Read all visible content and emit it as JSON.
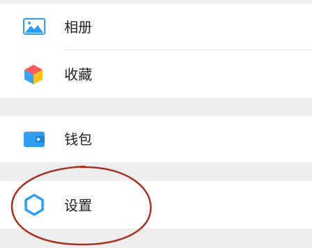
{
  "menu": {
    "items": [
      {
        "label": "相册",
        "icon": "photo-album-icon"
      },
      {
        "label": "收藏",
        "icon": "favorites-cube-icon"
      },
      {
        "label": "钱包",
        "icon": "wallet-icon"
      },
      {
        "label": "设置",
        "icon": "gear-icon"
      }
    ]
  },
  "colors": {
    "accent": "#2d9ef0",
    "highlight_circle": "#a8301e",
    "section_gap": "#ededed"
  }
}
